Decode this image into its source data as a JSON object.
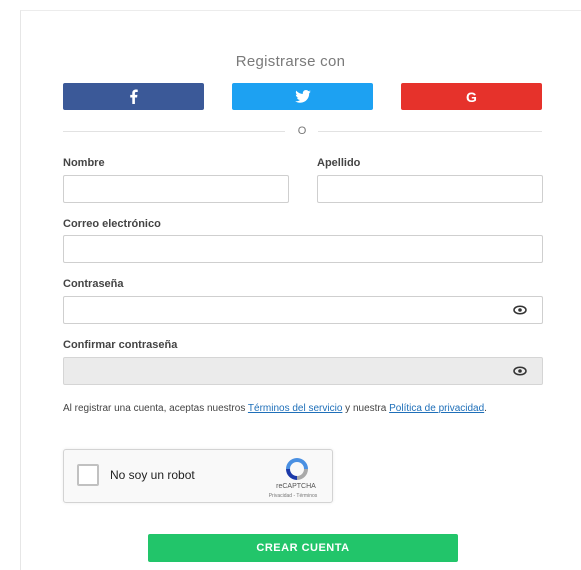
{
  "register": {
    "heading": "Registrarse con",
    "divider": "O",
    "social": {
      "facebook_icon": "facebook-icon",
      "twitter_icon": "twitter-icon",
      "google_letter": "G"
    }
  },
  "form": {
    "first_name_label": "Nombre",
    "last_name_label": "Apellido",
    "email_label": "Correo electrónico",
    "password_label": "Contraseña",
    "confirm_password_label": "Confirmar contraseña"
  },
  "terms": {
    "prefix": "Al registrar una cuenta, aceptas nuestros ",
    "tos_link": "Términos del servicio",
    "middle": " y nuestra ",
    "privacy_link": "Política de privacidad",
    "suffix": "."
  },
  "captcha": {
    "label": "No soy un robot",
    "brand": "reCAPTCHA",
    "links": "Privacidad - Términos"
  },
  "submit_label": "CREAR CUENTA",
  "colors": {
    "facebook": "#3b5998",
    "twitter": "#1da1f2",
    "google": "#e6322b",
    "submit": "#22c56a",
    "link": "#1e6fb9"
  }
}
